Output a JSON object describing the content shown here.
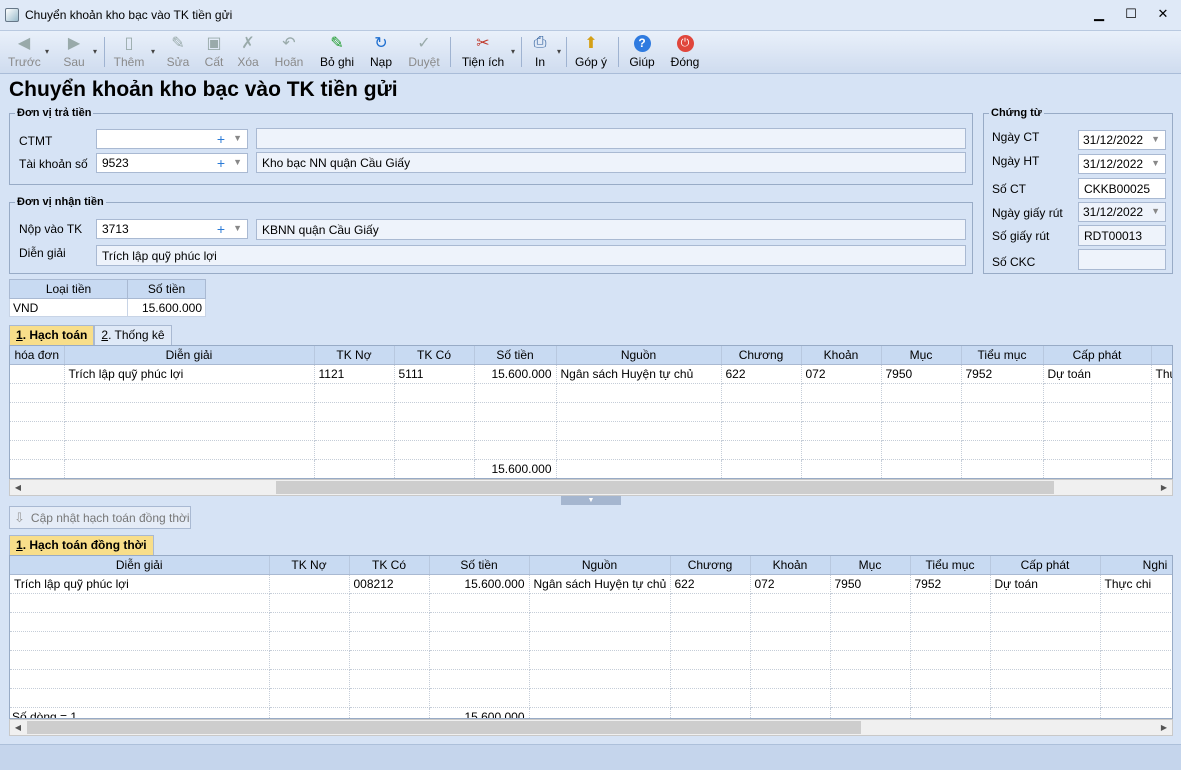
{
  "window": {
    "title": "Chuyển khoản kho bạc vào TK tiền gửi",
    "minimize": "▁",
    "maximize": "☐",
    "close": "✕"
  },
  "toolbar": {
    "items": [
      {
        "label": "Trước",
        "icon": "◀"
      },
      {
        "label": "Sau",
        "icon": "▶"
      },
      {
        "label": "Thêm",
        "icon": "▯"
      },
      {
        "label": "Sửa",
        "icon": "✎"
      },
      {
        "label": "Cất",
        "icon": "▣"
      },
      {
        "label": "Xóa",
        "icon": "✗"
      },
      {
        "label": "Hoãn",
        "icon": "↶"
      },
      {
        "label": "Bỏ ghi",
        "icon": "✎"
      },
      {
        "label": "Nạp",
        "icon": "↻"
      },
      {
        "label": "Duyệt",
        "icon": "✓"
      },
      {
        "label": "Tiện ích",
        "icon": "✂"
      },
      {
        "label": "In",
        "icon": "⎙"
      },
      {
        "label": "Góp ý",
        "icon": "⬆"
      },
      {
        "label": "Giúp",
        "icon": "?"
      },
      {
        "label": "Đóng",
        "icon": "⏻"
      }
    ],
    "dropdown_arrow": "▾"
  },
  "page_title": "Chuyển khoản kho bạc vào TK tiền gửi",
  "payer": {
    "legend": "Đơn vị trả tiền",
    "ctmt_label": "CTMT",
    "ctmt_value": "",
    "ctmt_desc": "",
    "account_label": "Tài khoản số",
    "account_value": "9523",
    "account_desc": "Kho bạc NN quận Cầu Giấy"
  },
  "payee": {
    "legend": "Đơn vị nhận tiền",
    "deposit_label": "Nộp vào TK",
    "deposit_value": "3713",
    "deposit_desc": "KBNN quận Cầu Giấy",
    "desc_label": "Diễn giải",
    "desc_value": "Trích lập quỹ phúc lợi"
  },
  "voucher": {
    "legend": "Chứng từ",
    "date_label": "Ngày CT",
    "date_value": "31/12/2022",
    "post_date_label": "Ngày HT",
    "post_date_value": "31/12/2022",
    "number_label": "Số CT",
    "number_value": "CKKB00025",
    "withdraw_date_label": "Ngày giấy rút",
    "withdraw_date_value": "31/12/2022",
    "withdraw_no_label": "Số giấy rút",
    "withdraw_no_value": "RDT00013",
    "ckc_label": "Số CKC",
    "ckc_value": ""
  },
  "currency_table": {
    "headers": [
      "Loại tiền",
      "Số tiền"
    ],
    "row": [
      "VND",
      "15.600.000"
    ]
  },
  "tabs_top": [
    {
      "num": "1",
      "label": ". Hạch toán"
    },
    {
      "num": "2",
      "label": ". Thống kê"
    }
  ],
  "grid1": {
    "headers": [
      "hóa đơn",
      "Diễn giải",
      "TK Nợ",
      "TK Có",
      "Số tiền",
      "Nguồn",
      "Chương",
      "Khoản",
      "Mục",
      "Tiểu mục",
      "Cấp phát",
      "N"
    ],
    "rows": [
      [
        "",
        "Trích lập quỹ phúc lợi",
        "1121",
        "5111",
        "15.600.000",
        "Ngân sách Huyện tự chủ",
        "622",
        "072",
        "7950",
        "7952",
        "Dự toán",
        "Thự"
      ]
    ],
    "total": "15.600.000"
  },
  "update_button": "Cập nhật hạch toán đồng thời",
  "tabs_bottom": [
    {
      "num": "1",
      "label": ". Hạch toán đồng thời"
    }
  ],
  "grid2": {
    "headers": [
      "Diễn giải",
      "TK Nợ",
      "TK Có",
      "Số tiền",
      "Nguồn",
      "Chương",
      "Khoản",
      "Mục",
      "Tiểu mục",
      "Cấp phát",
      "Nghi"
    ],
    "rows": [
      [
        "Trích lập quỹ phúc lợi",
        "",
        "008212",
        "15.600.000",
        "Ngân sách Huyện tự chủ",
        "622",
        "072",
        "7950",
        "7952",
        "Dự toán",
        "Thực chi"
      ]
    ],
    "row_count": "Số dòng = 1",
    "total": "15.600.000"
  },
  "colors": {
    "accent": "#f8de8a",
    "header": "#c8daf2",
    "background": "#d6e3f5"
  }
}
